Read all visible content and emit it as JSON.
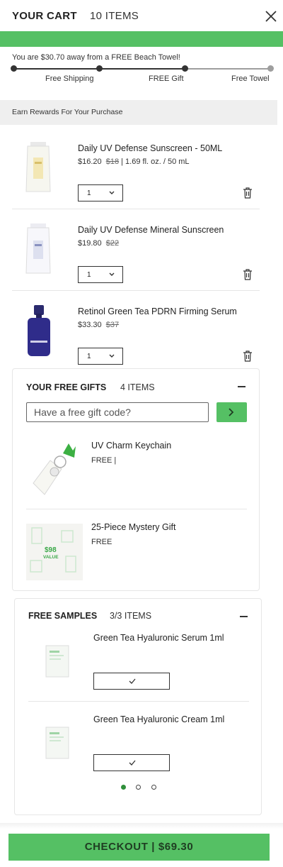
{
  "header": {
    "title": "YOUR CART",
    "count": "10 ITEMS"
  },
  "progress": {
    "message": "You are $30.70 away from a FREE Beach Towel!",
    "fraction": 0.67,
    "milestones": [
      "Free Shipping",
      "FREE Gift",
      "Free Towel"
    ]
  },
  "rewards": {
    "label": "Earn Rewards For Your Purchase"
  },
  "cart": {
    "items": [
      {
        "name": "Daily UV Defense Sunscreen - 50ML",
        "price": "$16.20",
        "old_price": "$18",
        "detail": "| 1.69 fl. oz. / 50 mL",
        "qty": "1"
      },
      {
        "name": "Daily UV Defense Mineral Sunscreen",
        "price": "$19.80",
        "old_price": "$22",
        "detail": "",
        "qty": "1"
      },
      {
        "name": "Retinol Green Tea PDRN Firming Serum",
        "price": "$33.30",
        "old_price": "$37",
        "detail": "",
        "qty": "1"
      }
    ]
  },
  "gifts": {
    "title": "YOUR FREE GIFTS",
    "count": "4 ITEMS",
    "placeholder": "Have a free gift code?",
    "items": [
      {
        "name": "UV Charm Keychain",
        "price": "FREE |"
      },
      {
        "name": "25-Piece Mystery Gift",
        "price": "FREE",
        "badge_top": "$98",
        "badge_bottom": "VALUE"
      }
    ]
  },
  "samples": {
    "title": "FREE SAMPLES",
    "count": "3/3 ITEMS",
    "items": [
      {
        "name": "Green Tea Hyaluronic Serum 1ml"
      },
      {
        "name": "Green Tea Hyaluronic Cream 1ml"
      }
    ],
    "page_dots": 3,
    "active_dot": 0
  },
  "checkout": {
    "label": "CHECKOUT | $69.30"
  },
  "colors": {
    "accent": "#55c064",
    "active_dot": "#2f8f3a"
  }
}
